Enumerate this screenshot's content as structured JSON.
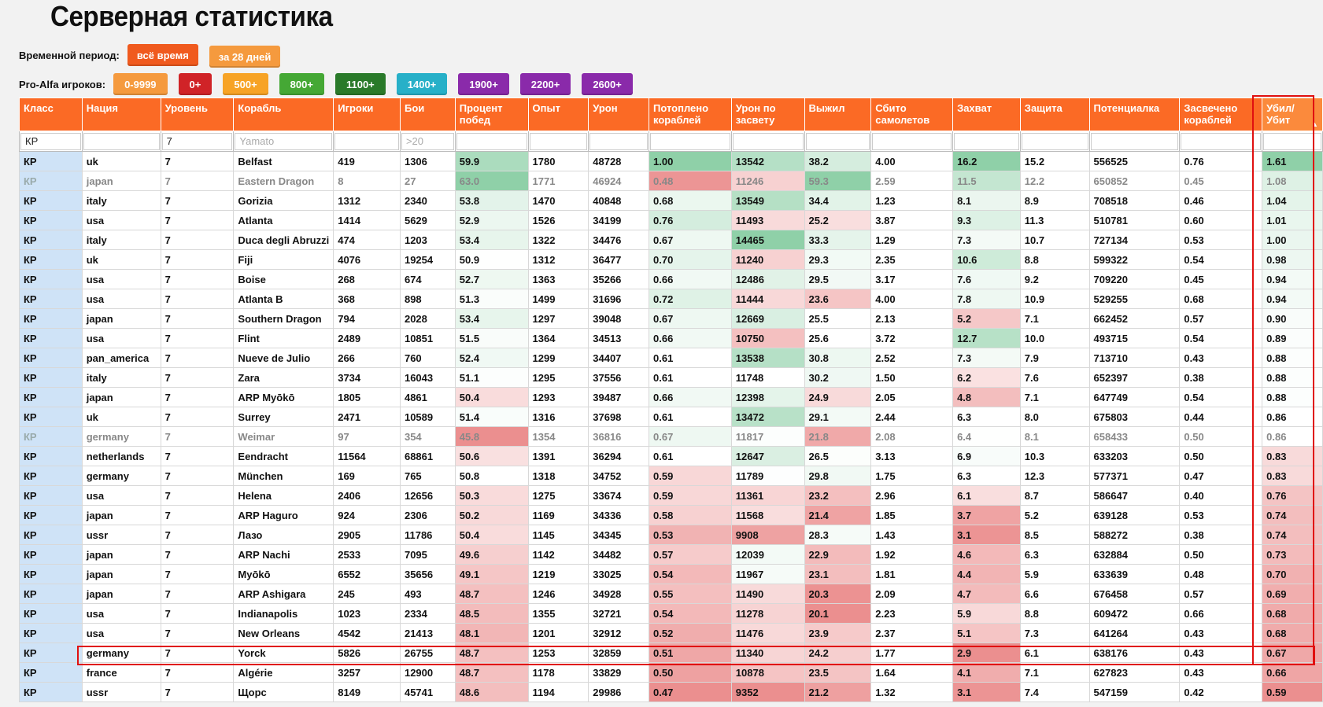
{
  "title": "Серверная статистика",
  "period": {
    "label": "Временной период:",
    "buttons": [
      {
        "label": "всё время",
        "color": "#f05a1e"
      },
      {
        "label": "за 28 дней",
        "color": "#f59a3e"
      }
    ]
  },
  "players": {
    "label": "Pro-Alfa игроков:",
    "buttons": [
      {
        "label": "0-9999",
        "color": "#f59a3e"
      },
      {
        "label": "0+",
        "color": "#d02327"
      },
      {
        "label": "500+",
        "color": "#f7a325"
      },
      {
        "label": "800+",
        "color": "#45a835"
      },
      {
        "label": "1100+",
        "color": "#2a7a2a"
      },
      {
        "label": "1400+",
        "color": "#27b0c8"
      },
      {
        "label": "1900+",
        "color": "#8a2aaa"
      },
      {
        "label": "2200+",
        "color": "#8a2aaa"
      },
      {
        "label": "2600+",
        "color": "#8a2aaa"
      }
    ]
  },
  "table": {
    "columns": [
      "Класс",
      "Нация",
      "Уровень",
      "Корабль",
      "Игроки",
      "Бои",
      "Процент побед",
      "Опыт",
      "Урон",
      "Потоплено кораблей",
      "Урон по засвету",
      "Выжил",
      "Сбито самолетов",
      "Захват",
      "Защита",
      "Потенциалка",
      "Засвечено кораблей",
      "Убил/ Убит"
    ],
    "filters": [
      "КР",
      "",
      "7",
      "",
      "",
      "",
      "",
      "",
      "",
      "",
      "",
      "",
      "",
      "",
      "",
      "",
      "",
      ""
    ],
    "filter_placeholders": [
      "",
      "",
      "",
      "Yamato",
      "",
      ">20",
      "",
      "",
      "",
      "",
      "",
      "",
      "",
      "",
      "",
      "",
      "",
      ""
    ],
    "rows": [
      [
        "КР",
        "uk",
        "7",
        "Belfast",
        "419",
        "1306",
        "59.9",
        "1780",
        "48728",
        "1.00",
        "13542",
        "38.2",
        "4.00",
        "16.2",
        "15.2",
        "556525",
        "0.76",
        "1.61"
      ],
      [
        "КР",
        "japan",
        "7",
        "Eastern Dragon",
        "8",
        "27",
        "63.0",
        "1771",
        "46924",
        "0.48",
        "11246",
        "59.3",
        "2.59",
        "11.5",
        "12.2",
        "650852",
        "0.45",
        "1.08"
      ],
      [
        "КР",
        "italy",
        "7",
        "Gorizia",
        "1312",
        "2340",
        "53.8",
        "1470",
        "40848",
        "0.68",
        "13549",
        "34.4",
        "1.23",
        "8.1",
        "8.9",
        "708518",
        "0.46",
        "1.04"
      ],
      [
        "КР",
        "usa",
        "7",
        "Atlanta",
        "1414",
        "5629",
        "52.9",
        "1526",
        "34199",
        "0.76",
        "11493",
        "25.2",
        "3.87",
        "9.3",
        "11.3",
        "510781",
        "0.60",
        "1.01"
      ],
      [
        "КР",
        "italy",
        "7",
        "Duca degli Abruzzi",
        "474",
        "1203",
        "53.4",
        "1322",
        "34476",
        "0.67",
        "14465",
        "33.3",
        "1.29",
        "7.3",
        "10.7",
        "727134",
        "0.53",
        "1.00"
      ],
      [
        "КР",
        "uk",
        "7",
        "Fiji",
        "4076",
        "19254",
        "50.9",
        "1312",
        "36477",
        "0.70",
        "11240",
        "29.3",
        "2.35",
        "10.6",
        "8.8",
        "599322",
        "0.54",
        "0.98"
      ],
      [
        "КР",
        "usa",
        "7",
        "Boise",
        "268",
        "674",
        "52.7",
        "1363",
        "35266",
        "0.66",
        "12486",
        "29.5",
        "3.17",
        "7.6",
        "9.2",
        "709220",
        "0.45",
        "0.94"
      ],
      [
        "КР",
        "usa",
        "7",
        "Atlanta B",
        "368",
        "898",
        "51.3",
        "1499",
        "31696",
        "0.72",
        "11444",
        "23.6",
        "4.00",
        "7.8",
        "10.9",
        "529255",
        "0.68",
        "0.94"
      ],
      [
        "КР",
        "japan",
        "7",
        "Southern Dragon",
        "794",
        "2028",
        "53.4",
        "1297",
        "39048",
        "0.67",
        "12669",
        "25.5",
        "2.13",
        "5.2",
        "7.1",
        "662452",
        "0.57",
        "0.90"
      ],
      [
        "КР",
        "usa",
        "7",
        "Flint",
        "2489",
        "10851",
        "51.5",
        "1364",
        "34513",
        "0.66",
        "10750",
        "25.6",
        "3.72",
        "12.7",
        "10.0",
        "493715",
        "0.54",
        "0.89"
      ],
      [
        "КР",
        "pan_america",
        "7",
        "Nueve de Julio",
        "266",
        "760",
        "52.4",
        "1299",
        "34407",
        "0.61",
        "13538",
        "30.8",
        "2.52",
        "7.3",
        "7.9",
        "713710",
        "0.43",
        "0.88"
      ],
      [
        "КР",
        "italy",
        "7",
        "Zara",
        "3734",
        "16043",
        "51.1",
        "1295",
        "37556",
        "0.61",
        "11748",
        "30.2",
        "1.50",
        "6.2",
        "7.6",
        "652397",
        "0.38",
        "0.88"
      ],
      [
        "КР",
        "japan",
        "7",
        "ARP Myōkō",
        "1805",
        "4861",
        "50.4",
        "1293",
        "39487",
        "0.66",
        "12398",
        "24.9",
        "2.05",
        "4.8",
        "7.1",
        "647749",
        "0.54",
        "0.88"
      ],
      [
        "КР",
        "uk",
        "7",
        "Surrey",
        "2471",
        "10589",
        "51.4",
        "1316",
        "37698",
        "0.61",
        "13472",
        "29.1",
        "2.44",
        "6.3",
        "8.0",
        "675803",
        "0.44",
        "0.86"
      ],
      [
        "КР",
        "germany",
        "7",
        "Weimar",
        "97",
        "354",
        "45.8",
        "1354",
        "36816",
        "0.67",
        "11817",
        "21.8",
        "2.08",
        "6.4",
        "8.1",
        "658433",
        "0.50",
        "0.86"
      ],
      [
        "КР",
        "netherlands",
        "7",
        "Eendracht",
        "11564",
        "68861",
        "50.6",
        "1391",
        "36294",
        "0.61",
        "12647",
        "26.5",
        "3.13",
        "6.9",
        "10.3",
        "633203",
        "0.50",
        "0.83"
      ],
      [
        "КР",
        "germany",
        "7",
        "München",
        "169",
        "765",
        "50.8",
        "1318",
        "34752",
        "0.59",
        "11789",
        "29.8",
        "1.75",
        "6.3",
        "12.3",
        "577371",
        "0.47",
        "0.83"
      ],
      [
        "КР",
        "usa",
        "7",
        "Helena",
        "2406",
        "12656",
        "50.3",
        "1275",
        "33674",
        "0.59",
        "11361",
        "23.2",
        "2.96",
        "6.1",
        "8.7",
        "586647",
        "0.40",
        "0.76"
      ],
      [
        "КР",
        "japan",
        "7",
        "ARP Haguro",
        "924",
        "2306",
        "50.2",
        "1169",
        "34336",
        "0.58",
        "11568",
        "21.4",
        "1.85",
        "3.7",
        "5.2",
        "639128",
        "0.53",
        "0.74"
      ],
      [
        "КР",
        "ussr",
        "7",
        "Лазо",
        "2905",
        "11786",
        "50.4",
        "1145",
        "34345",
        "0.53",
        "9908",
        "28.3",
        "1.43",
        "3.1",
        "8.5",
        "588272",
        "0.38",
        "0.74"
      ],
      [
        "КР",
        "japan",
        "7",
        "ARP Nachi",
        "2533",
        "7095",
        "49.6",
        "1142",
        "34482",
        "0.57",
        "12039",
        "22.9",
        "1.92",
        "4.6",
        "6.3",
        "632884",
        "0.50",
        "0.73"
      ],
      [
        "КР",
        "japan",
        "7",
        "Myōkō",
        "6552",
        "35656",
        "49.1",
        "1219",
        "33025",
        "0.54",
        "11967",
        "23.1",
        "1.81",
        "4.4",
        "5.9",
        "633639",
        "0.48",
        "0.70"
      ],
      [
        "КР",
        "japan",
        "7",
        "ARP Ashigara",
        "245",
        "493",
        "48.7",
        "1246",
        "34928",
        "0.55",
        "11490",
        "20.3",
        "2.09",
        "4.7",
        "6.6",
        "676458",
        "0.57",
        "0.69"
      ],
      [
        "КР",
        "usa",
        "7",
        "Indianapolis",
        "1023",
        "2334",
        "48.5",
        "1355",
        "32721",
        "0.54",
        "11278",
        "20.1",
        "2.23",
        "5.9",
        "8.8",
        "609472",
        "0.66",
        "0.68"
      ],
      [
        "КР",
        "usa",
        "7",
        "New Orleans",
        "4542",
        "21413",
        "48.1",
        "1201",
        "32912",
        "0.52",
        "11476",
        "23.9",
        "2.37",
        "5.1",
        "7.3",
        "641264",
        "0.43",
        "0.68"
      ],
      [
        "КР",
        "germany",
        "7",
        "Yorck",
        "5826",
        "26755",
        "48.7",
        "1253",
        "32859",
        "0.51",
        "11340",
        "24.2",
        "1.77",
        "2.9",
        "6.1",
        "638176",
        "0.43",
        "0.67"
      ],
      [
        "КР",
        "france",
        "7",
        "Algérie",
        "3257",
        "12900",
        "48.7",
        "1178",
        "33829",
        "0.50",
        "10878",
        "23.5",
        "1.64",
        "4.1",
        "7.1",
        "627823",
        "0.43",
        "0.66"
      ],
      [
        "КР",
        "ussr",
        "7",
        "Щорс",
        "8149",
        "45741",
        "48.6",
        "1194",
        "29986",
        "0.47",
        "9352",
        "21.2",
        "1.32",
        "3.1",
        "7.4",
        "547159",
        "0.42",
        "0.59"
      ]
    ],
    "dim_rows": [
      1,
      14
    ],
    "highlighted_row": 25,
    "heat_columns": [
      6,
      9,
      10,
      11,
      13,
      17
    ],
    "sorted_column": 17
  },
  "colors": {
    "header": "#fb6a25",
    "class_cell": "#cfe3f7",
    "highlight_border": "#e01010",
    "heat_good": "#8fd0a8",
    "heat_bad": "#eb8f8f"
  }
}
